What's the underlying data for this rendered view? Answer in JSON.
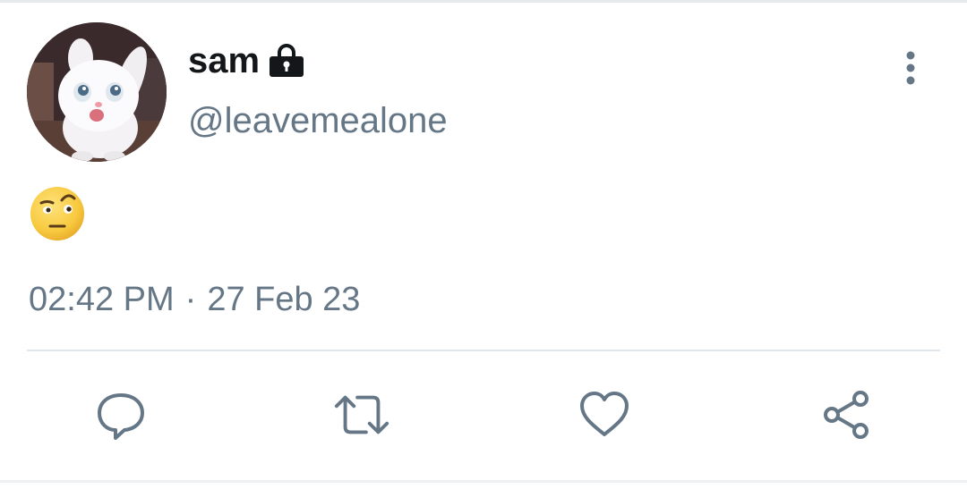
{
  "tweet": {
    "display_name": "sam",
    "handle": "@leavemealone",
    "text_emoji": "face-with-raised-eyebrow",
    "time": "02:42 PM",
    "separator": "·",
    "date": "27 Feb 23"
  },
  "icons": {
    "lock": "lock-icon",
    "more": "more-vertical-icon",
    "reply": "reply-icon",
    "retweet": "retweet-icon",
    "like": "heart-icon",
    "share": "share-icon"
  },
  "colors": {
    "name": "#14171a",
    "secondary": "#657786",
    "icon": "#657786",
    "divider": "#e1e8ed",
    "emoji_face": "#f7c93e"
  }
}
